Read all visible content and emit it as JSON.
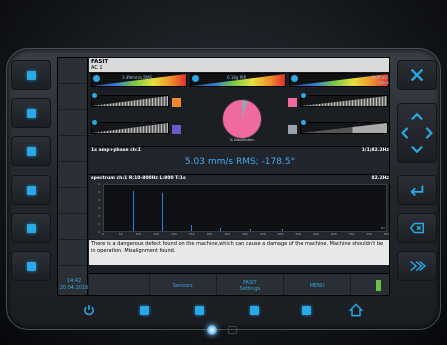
{
  "header": {
    "title": "FASIT",
    "subtitle": "AC 1"
  },
  "fasit": {
    "bars": [
      {
        "icon": "bearing-icon",
        "label": "3.49mm/s RMS"
      },
      {
        "icon": "gear-icon",
        "label": "0.16g PtP"
      },
      {
        "icon": "motor-icon",
        "label": "0.09 m/s wave"
      }
    ],
    "pie_caption": "% Distribution",
    "colors": {
      "orange": "#f08a2a",
      "pink": "#ef6aa0",
      "purple": "#6a5acd",
      "gray": "#9aa3ad"
    },
    "distribution": {
      "pink_fraction": 0.95
    }
  },
  "amp": {
    "title": "1x amp+phase ch:1",
    "right": "1/1;82.2Hz",
    "value": "5.03 mm/s RMS; -178.5°"
  },
  "spectrum": {
    "title": "spectrum ch:1 R:10-800Hz L:800 T:1s",
    "right": "82.2Hz",
    "unit": "mm/s RMS",
    "hz": "Hz",
    "yticks": [
      "6",
      "5",
      "4",
      "3",
      "2",
      "1",
      "0"
    ],
    "xticks": [
      "0",
      "50",
      "100",
      "150",
      "200",
      "250",
      "300",
      "350",
      "400",
      "450",
      "500",
      "550",
      "600",
      "650",
      "700",
      "750",
      "800"
    ]
  },
  "chart_data": {
    "type": "bar",
    "xlim": [
      0,
      800
    ],
    "ylim": [
      0,
      6
    ],
    "x": [
      82,
      164,
      246,
      328,
      410,
      500
    ],
    "values": [
      5.0,
      4.8,
      0.8,
      0.4,
      0.3,
      0.2
    ]
  },
  "message": "There is a dangerous defect found on the machine,which can cause a damage of the machine. Machine shouldn't be in operation. Misalignment found.",
  "menu": {
    "sensors": "Sensors",
    "fasit_settings": "FASIT\nSettings",
    "menu": "MENU"
  },
  "clock": {
    "time": "14:42",
    "date": "20.04.2018"
  },
  "accent": "#2aa9e6"
}
